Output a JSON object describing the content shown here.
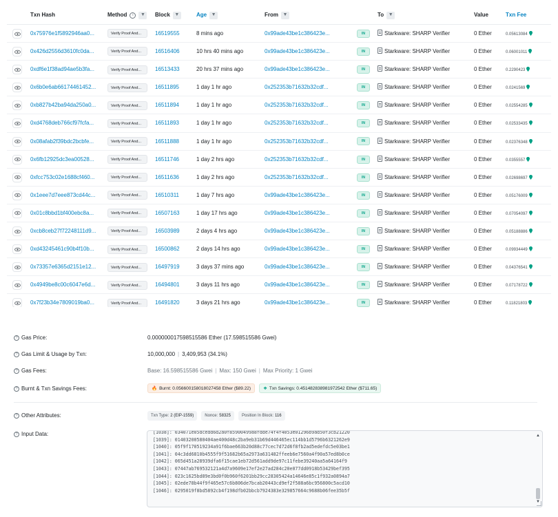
{
  "table": {
    "headers": {
      "hash": "Txn Hash",
      "method": "Method",
      "block": "Block",
      "age": "Age",
      "from": "From",
      "to": "To",
      "value": "Value",
      "fee": "Txn Fee"
    },
    "rows": [
      {
        "hash": "0x75976e1f5892946aa0...",
        "method": "Verify Proof And...",
        "block": "16519555",
        "age": "8 mins ago",
        "from": "0x99ade43be1c386423e...",
        "dir": "IN",
        "to": "Starkware: SHARP Verifier",
        "value": "0 Ether",
        "fee": "0.05613084"
      },
      {
        "hash": "0x426d2556d3610fc0da...",
        "method": "Verify Proof And...",
        "block": "16516406",
        "age": "10 hrs 40 mins ago",
        "from": "0x99ade43be1c386423e...",
        "dir": "IN",
        "to": "Starkware: SHARP Verifier",
        "value": "0 Ether",
        "fee": "0.06001011"
      },
      {
        "hash": "0xdf6e1f38ad94ae5b3fa...",
        "method": "Verify Proof And...",
        "block": "16513433",
        "age": "20 hrs 37 mins ago",
        "from": "0x99ade43be1c386423e...",
        "dir": "IN",
        "to": "Starkware: SHARP Verifier",
        "value": "0 Ether",
        "fee": "0.2290423"
      },
      {
        "hash": "0x6b0e6ab66174461452...",
        "method": "Verify Proof And...",
        "block": "16511895",
        "age": "1 day 1 hr ago",
        "from": "0x252353b71632b32cdf...",
        "dir": "IN",
        "to": "Starkware: SHARP Verifier",
        "value": "0 Ether",
        "fee": "0.0241569"
      },
      {
        "hash": "0xb827b42ba94da250a0...",
        "method": "Verify Proof And...",
        "block": "16511894",
        "age": "1 day 1 hr ago",
        "from": "0x252353b71632b32cdf...",
        "dir": "IN",
        "to": "Starkware: SHARP Verifier",
        "value": "0 Ether",
        "fee": "0.02554285"
      },
      {
        "hash": "0xd4768deb766cf97fcfa...",
        "method": "Verify Proof And...",
        "block": "16511893",
        "age": "1 day 1 hr ago",
        "from": "0x252353b71632b32cdf...",
        "dir": "IN",
        "to": "Starkware: SHARP Verifier",
        "value": "0 Ether",
        "fee": "0.02533435"
      },
      {
        "hash": "0x08afab2f39bdc2bcbfe...",
        "method": "Verify Proof And...",
        "block": "16511888",
        "age": "1 day 1 hr ago",
        "from": "0x252353b71632b32cdf...",
        "dir": "IN",
        "to": "Starkware: SHARP Verifier",
        "value": "0 Ether",
        "fee": "0.02376348"
      },
      {
        "hash": "0x6fb12925dc3ea00528...",
        "method": "Verify Proof And...",
        "block": "16511746",
        "age": "1 day 2 hrs ago",
        "from": "0x252353b71632b32cdf...",
        "dir": "IN",
        "to": "Starkware: SHARP Verifier",
        "value": "0 Ether",
        "fee": "0.0355557"
      },
      {
        "hash": "0xfcc753c02e1688cf460...",
        "method": "Verify Proof And...",
        "block": "16511636",
        "age": "1 day 2 hrs ago",
        "from": "0x252353b71632b32cdf...",
        "dir": "IN",
        "to": "Starkware: SHARP Verifier",
        "value": "0 Ether",
        "fee": "0.02698697"
      },
      {
        "hash": "0x1eee7d7eee873cd44c...",
        "method": "Verify Proof And...",
        "block": "16510311",
        "age": "1 day 7 hrs ago",
        "from": "0x99ade43be1c386423e...",
        "dir": "IN",
        "to": "Starkware: SHARP Verifier",
        "value": "0 Ether",
        "fee": "0.05176009"
      },
      {
        "hash": "0x01c8bbd1bf400ebc8a...",
        "method": "Verify Proof And...",
        "block": "16507163",
        "age": "1 day 17 hrs ago",
        "from": "0x99ade43be1c386423e...",
        "dir": "IN",
        "to": "Starkware: SHARP Verifier",
        "value": "0 Ether",
        "fee": "0.07054097"
      },
      {
        "hash": "0xcb8ceb27f72248111d9...",
        "method": "Verify Proof And...",
        "block": "16503989",
        "age": "2 days 4 hrs ago",
        "from": "0x99ade43be1c386423e...",
        "dir": "IN",
        "to": "Starkware: SHARP Verifier",
        "value": "0 Ether",
        "fee": "0.05188886"
      },
      {
        "hash": "0xd43245461c90b4f10b...",
        "method": "Verify Proof And...",
        "block": "16500862",
        "age": "2 days 14 hrs ago",
        "from": "0x99ade43be1c386423e...",
        "dir": "IN",
        "to": "Starkware: SHARP Verifier",
        "value": "0 Ether",
        "fee": "0.09934449"
      },
      {
        "hash": "0x73357e6365d2151e12...",
        "method": "Verify Proof And...",
        "block": "16497919",
        "age": "3 days 37 mins ago",
        "from": "0x99ade43be1c386423e...",
        "dir": "IN",
        "to": "Starkware: SHARP Verifier",
        "value": "0 Ether",
        "fee": "0.04376541"
      },
      {
        "hash": "0x4949be8c00c6047e6d...",
        "method": "Verify Proof And...",
        "block": "16494801",
        "age": "3 days 11 hrs ago",
        "from": "0x99ade43be1c386423e...",
        "dir": "IN",
        "to": "Starkware: SHARP Verifier",
        "value": "0 Ether",
        "fee": "0.07178722"
      },
      {
        "hash": "0x7f23b34e7809019ba0...",
        "method": "Verify Proof And...",
        "block": "16491820",
        "age": "3 days 21 hrs ago",
        "from": "0x99ade43be1c386423e...",
        "dir": "IN",
        "to": "Starkware: SHARP Verifier",
        "value": "0 Ether",
        "fee": "0.11821803"
      }
    ]
  },
  "details": {
    "gas_price": {
      "label": "Gas Price:",
      "value": "0.000000017598515586 Ether (17.598515586 Gwei)"
    },
    "gas_limit": {
      "label": "Gas Limit & Usage by Txn:",
      "limit": "10,000,000",
      "usage": "3,409,953 (34.1%)"
    },
    "gas_fees": {
      "label": "Gas Fees:",
      "base": "Base: 16.598515586 Gwei",
      "max": "Max: 150 Gwei",
      "max_priority": "Max Priority: 1 Gwei"
    },
    "burnt": {
      "label": "Burnt & Txn Savings Fees:",
      "burnt": "Burnt: 0.056600158018027458 Ether ($89.22)",
      "savings": "Txn Savings: 0.451482838981972542 Ether ($711.65)"
    },
    "other": {
      "label": "Other Attributes:",
      "txn_type_label": "Txn Type:",
      "txn_type": "2 (EIP-1559)",
      "nonce_label": "Nonce:",
      "nonce": "58325",
      "position_label": "Position In Block:",
      "position": "116"
    },
    "input": {
      "label": "Input Data:",
      "lines": [
        "[1038]: 034071e05dcedd6d2a0f85900499a8fdde74f4f4053e01296b9ad50f3cb21220",
        "[1039]: 01403200580404ae400d48c2ba9eb31b69d446465ec114bb1d5796b6321262e9",
        "[1040]: 05f9f170519234a91f6bae663b20d88c77cec7d72d6f8fb2ad5edefdc5e03be1",
        "[1041]: 04c3dd6810b4555f9f51682b65a2973a631482ffeeb6e7560a4f90a57ed8b0ce",
        "[1042]: 065d451a28939dfa6f15cae1eb72d561add9de97c11febe39240aa5a64164f9",
        "[1043]: 07447ab769532121a4d7a9609e17ef2e27ad284c20e077dd0918b53429bef395",
        "[1044]: 023c1625bd89e3bd0f0b960f6201bb29cc28305424a14646e85c1f932a0894a7",
        "[1045]: 02ede78b44f9f465e57c6b806de7bcab20443cd9ef2f588a6bc956800c5acd10",
        "[1046]: 0295019f8bd5892cb4f198dfb02bbcb7924383e329857664c9688b06fee35b5f"
      ]
    }
  },
  "colors": {
    "link": "#0784c3",
    "in_badge": "#00a186",
    "burnt_bg": "#fcefe6",
    "savings_bg": "#e9f7f1"
  }
}
